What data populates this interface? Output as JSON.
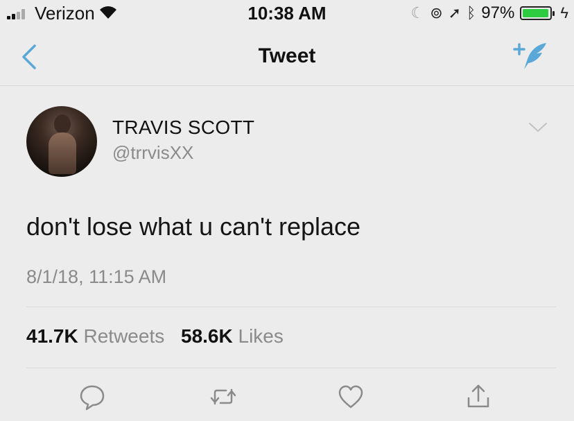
{
  "status_bar": {
    "carrier": "Verizon",
    "time": "10:38 AM",
    "battery_percent": "97%",
    "battery_level": 0.97,
    "battery_color": "#2ecc40",
    "icons": [
      "signal-icon",
      "wifi-icon",
      "moon-icon",
      "lock-rotation-icon",
      "location-icon",
      "bluetooth-icon",
      "battery-icon",
      "charging-icon"
    ]
  },
  "nav": {
    "title": "Tweet",
    "back_icon": "chevron-left-icon",
    "compose_icon": "compose-tweet-icon",
    "accent_color": "#5aa8d8"
  },
  "tweet": {
    "author_name": "TRAVIS SCOTT",
    "author_handle": "@trrvisXX",
    "text": "don't lose what u can't replace",
    "timestamp": "8/1/18, 11:15 AM",
    "retweets_count": "41.7K",
    "retweets_label": "Retweets",
    "likes_count": "58.6K",
    "likes_label": "Likes"
  },
  "actions": [
    "reply-icon",
    "retweet-icon",
    "like-icon",
    "share-icon"
  ]
}
